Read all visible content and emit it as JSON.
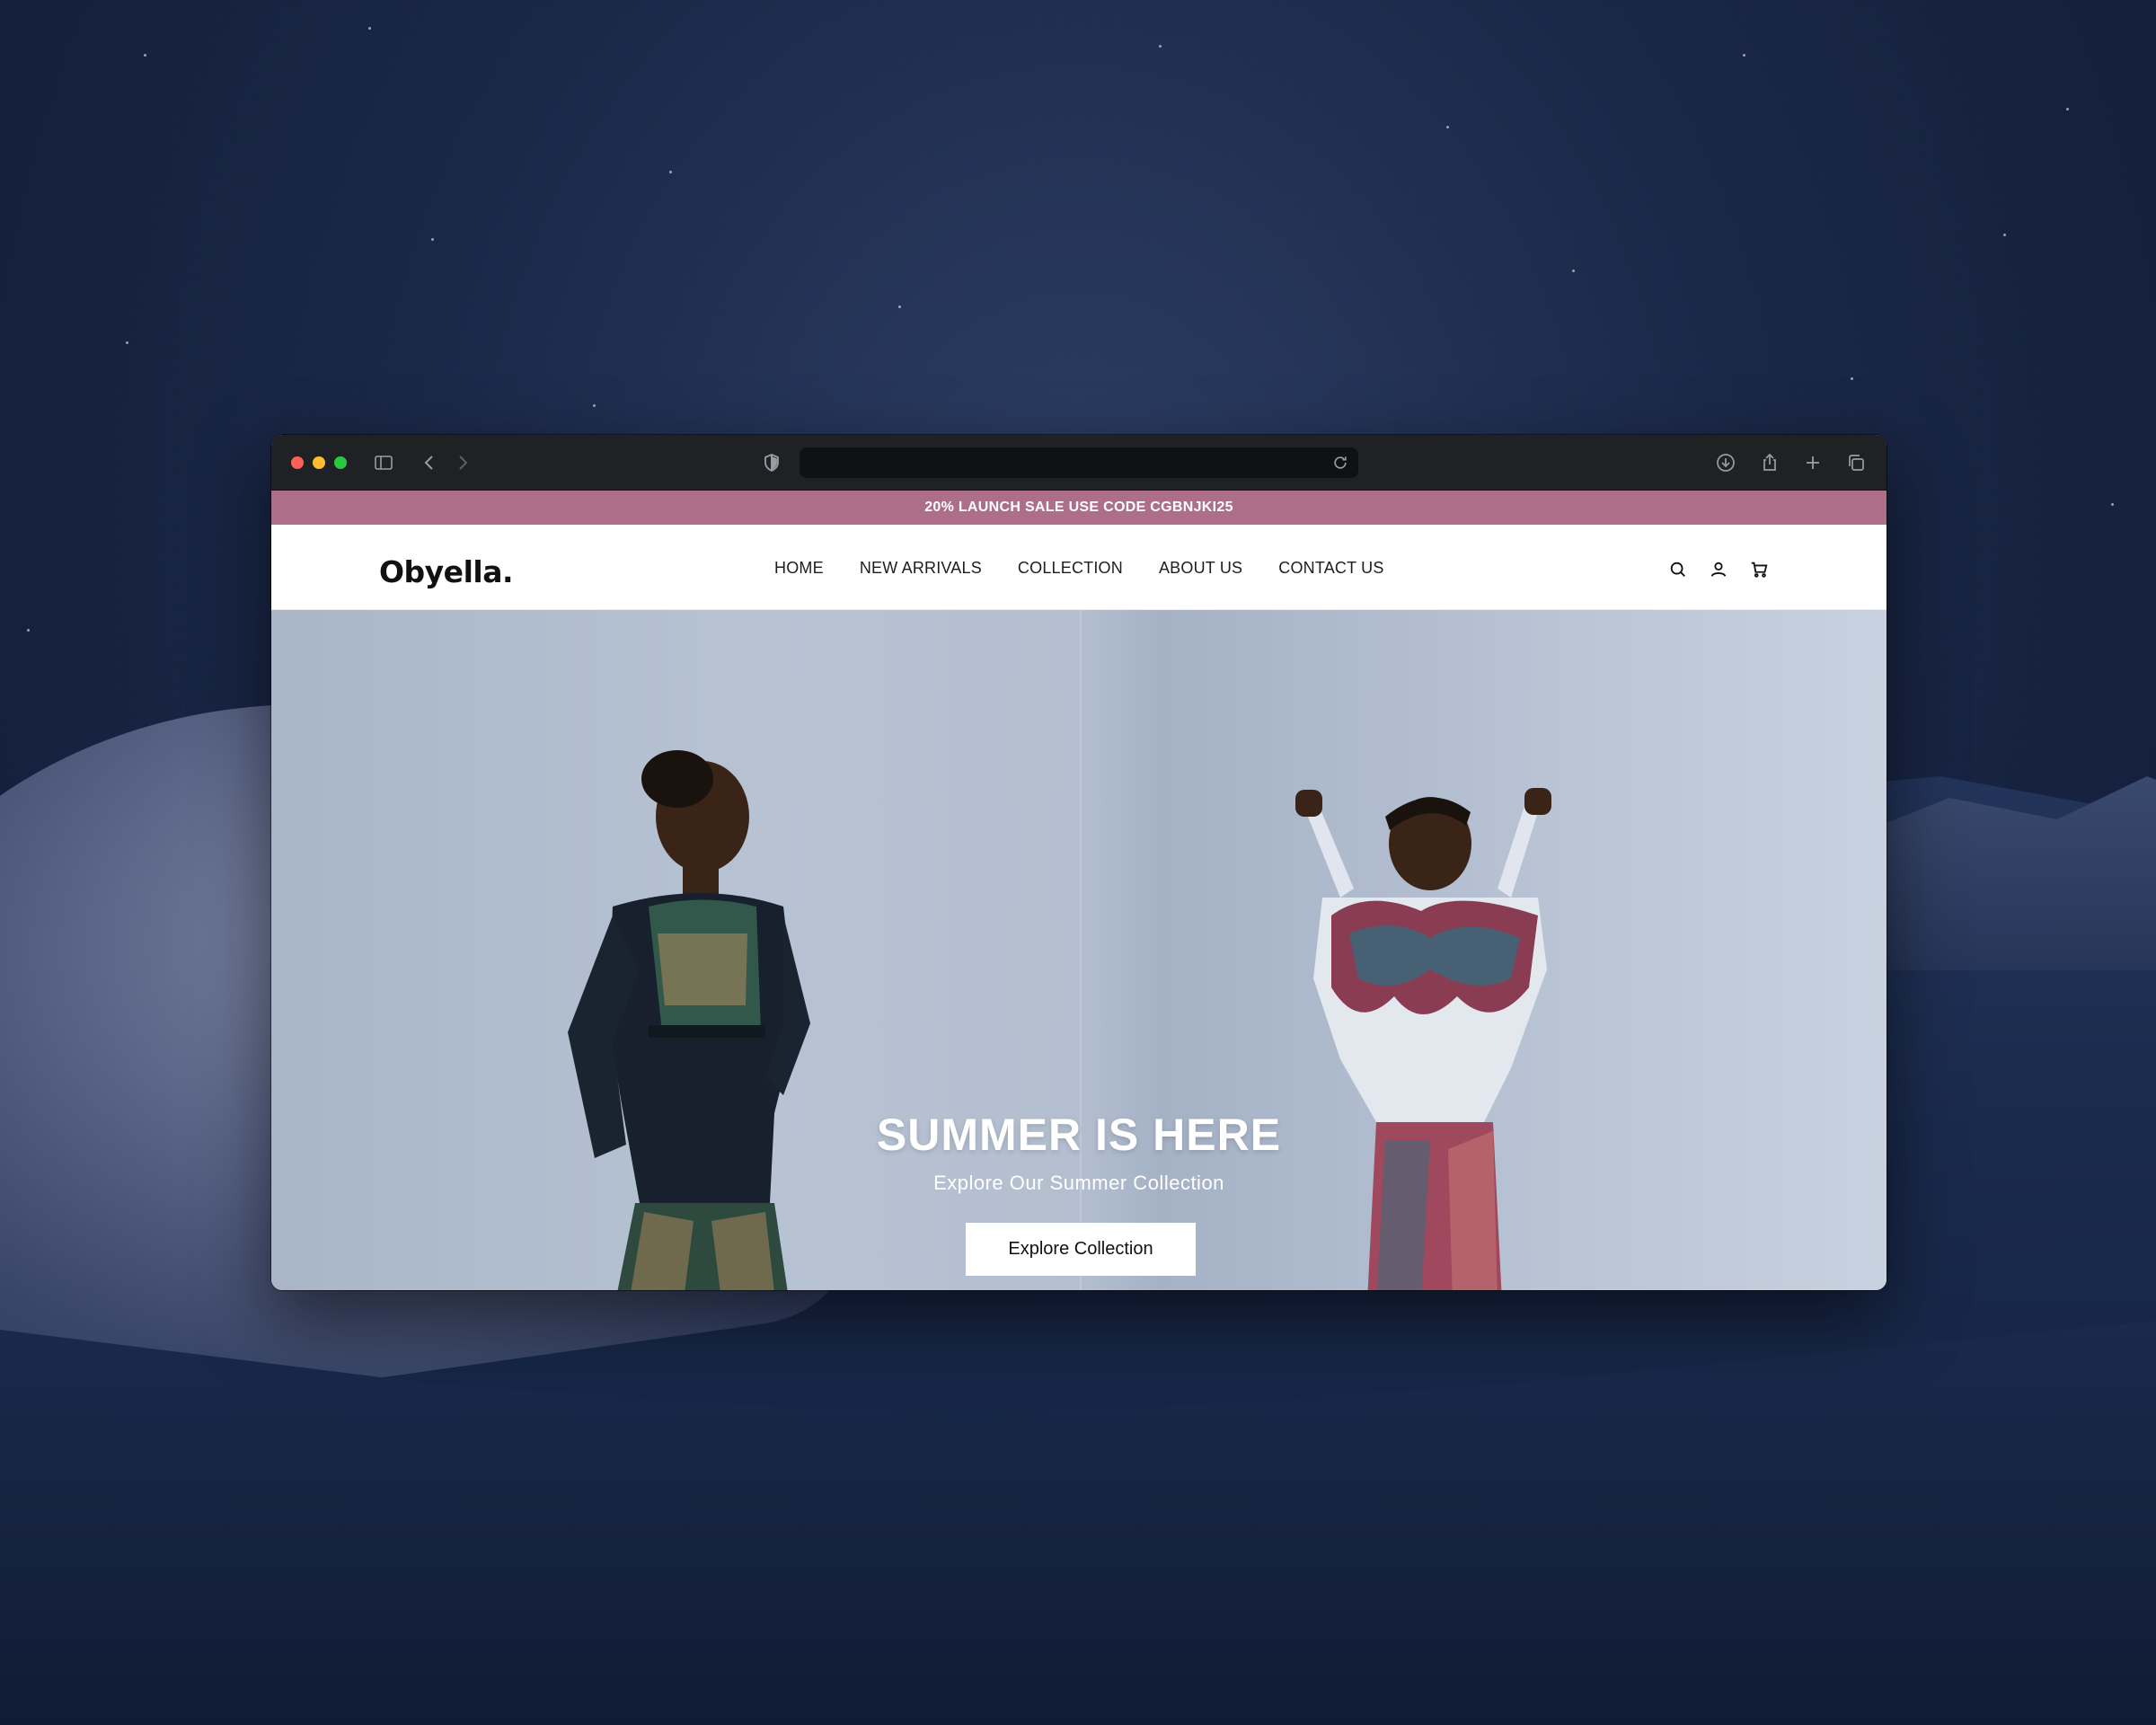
{
  "promo_bar": {
    "text": "20% LAUNCH SALE USE CODE CGBNJKI25",
    "color": "#ad6e8a"
  },
  "browser": {
    "toolbar_icons": [
      "sidebar-icon",
      "back-icon",
      "forward-icon",
      "shield-icon",
      "reload-icon",
      "download-icon",
      "share-icon",
      "new-tab-icon",
      "tabs-overview-icon"
    ],
    "address_value": ""
  },
  "header": {
    "logo": "Obyella.",
    "nav": [
      "HOME",
      "NEW ARRIVALS",
      "COLLECTION",
      "ABOUT US",
      "CONTACT US"
    ],
    "icons": [
      "search-icon",
      "account-icon",
      "cart-icon"
    ]
  },
  "hero": {
    "title": "SUMMER IS HERE",
    "subtitle": "Explore Our Summer Collection",
    "button": "Explore Collection"
  }
}
